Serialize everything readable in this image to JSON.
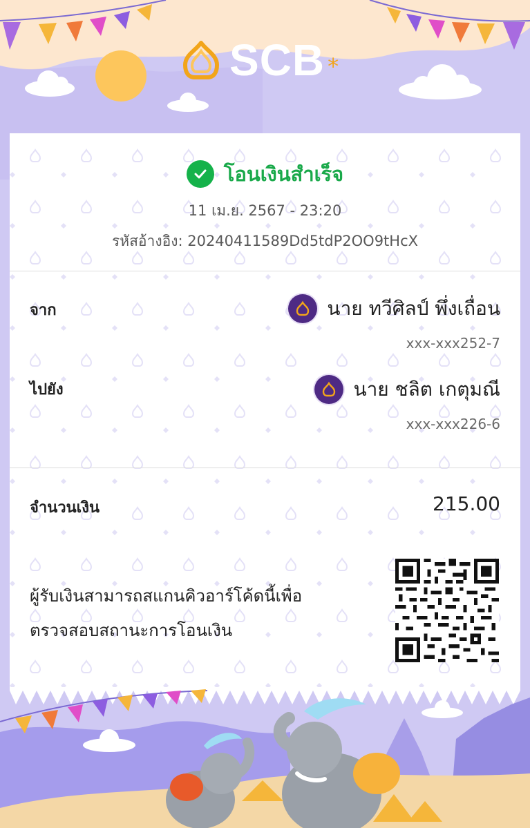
{
  "brand": {
    "name": "SCB",
    "star": "*"
  },
  "status": {
    "text": "โอนเงินสำเร็จ",
    "icon": "check-circle-icon",
    "color": "#15b24a"
  },
  "datetime": "11 เม.ย. 2567 - 23:20",
  "reference": {
    "label": "รหัสอ้างอิง:",
    "value": "20240411589Dd5tdP2OO9tHcX"
  },
  "from": {
    "label": "จาก",
    "name": "นาย ทวีศิลป์ พึ่งเถื่อน",
    "account": "xxx-xxx252-7",
    "bank_icon": "scb-logo-icon"
  },
  "to": {
    "label": "ไปยัง",
    "name": "นาย ชลิต เกตุมณี",
    "account": "xxx-xxx226-6",
    "bank_icon": "scb-logo-icon"
  },
  "amount": {
    "label": "จำนวนเงิน",
    "value": "215.00"
  },
  "qr_note": {
    "line1": "ผู้รับเงินสามารถสแกนคิวอาร์โค้ดนี้เพื่อ",
    "line2": "ตรวจสอบสถานะการโอนเงิน"
  },
  "colors": {
    "brand_purple": "#4e2a84",
    "accent_gold": "#f2a51a",
    "background": "#cfc9f3"
  }
}
